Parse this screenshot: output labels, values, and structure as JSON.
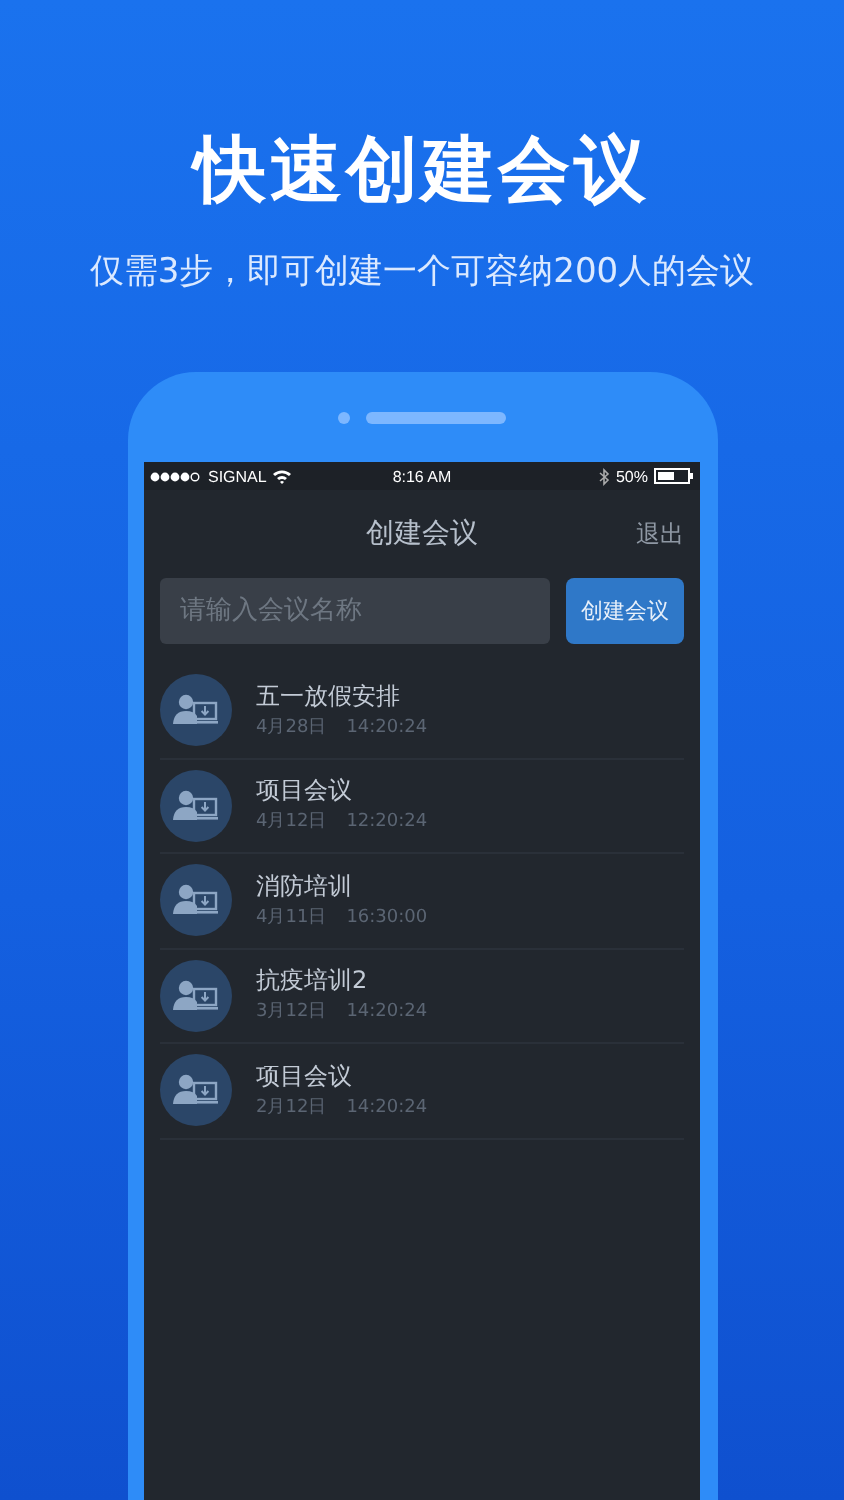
{
  "headline": "快速创建会议",
  "subtitle": "仅需3步，即可创建一个可容纳200人的会议",
  "status_bar": {
    "carrier": "SIGNAL",
    "time": "8:16 AM",
    "battery": "50%"
  },
  "nav_bar": {
    "title": "创建会议",
    "action": "退出"
  },
  "create_form": {
    "placeholder": "请输入会议名称",
    "button": "创建会议"
  },
  "meetings": [
    {
      "title": "五一放假安排",
      "date": "4月28日",
      "time": "14:20:24"
    },
    {
      "title": "项目会议",
      "date": "4月12日",
      "time": "12:20:24"
    },
    {
      "title": "消防培训",
      "date": "4月11日",
      "time": "16:30:00"
    },
    {
      "title": "抗疫培训2",
      "date": "3月12日",
      "time": "14:20:24"
    },
    {
      "title": "项目会议",
      "date": "2月12日",
      "time": "14:20:24"
    }
  ]
}
